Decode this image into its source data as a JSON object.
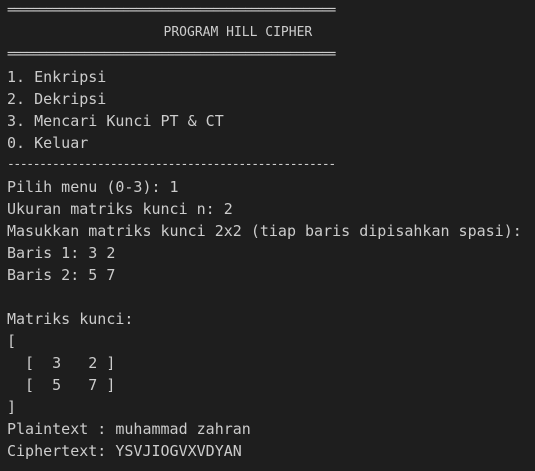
{
  "header": {
    "rule_top": "===================================================",
    "title": "                    PROGRAM HILL CIPHER",
    "rule_bottom": "==================================================="
  },
  "menu": {
    "items": [
      "1. Enkripsi",
      "2. Dekripsi",
      "3. Mencari Kunci PT & CT",
      "0. Keluar"
    ],
    "separator": "---------------------------------------------------"
  },
  "session": {
    "menu_prompt": "Pilih menu (0-3): 1",
    "size_prompt": "Ukuran matriks kunci n: 2",
    "matrix_prompt": "Masukkan matriks kunci 2x2 (tiap baris dipisahkan spasi):",
    "row1_input": "Baris 1: 3 2",
    "row2_input": "Baris 2: 5 7",
    "blank": "",
    "matrix_label": "Matriks kunci:",
    "open_bracket": "[",
    "matrix_rows": [
      "  [  3   2 ]",
      "  [  5   7 ]"
    ],
    "close_bracket": "]",
    "plaintext_line": "Plaintext : muhammad zahran",
    "ciphertext_line": "Ciphertext: YSVJIOGVXVDYAN"
  }
}
